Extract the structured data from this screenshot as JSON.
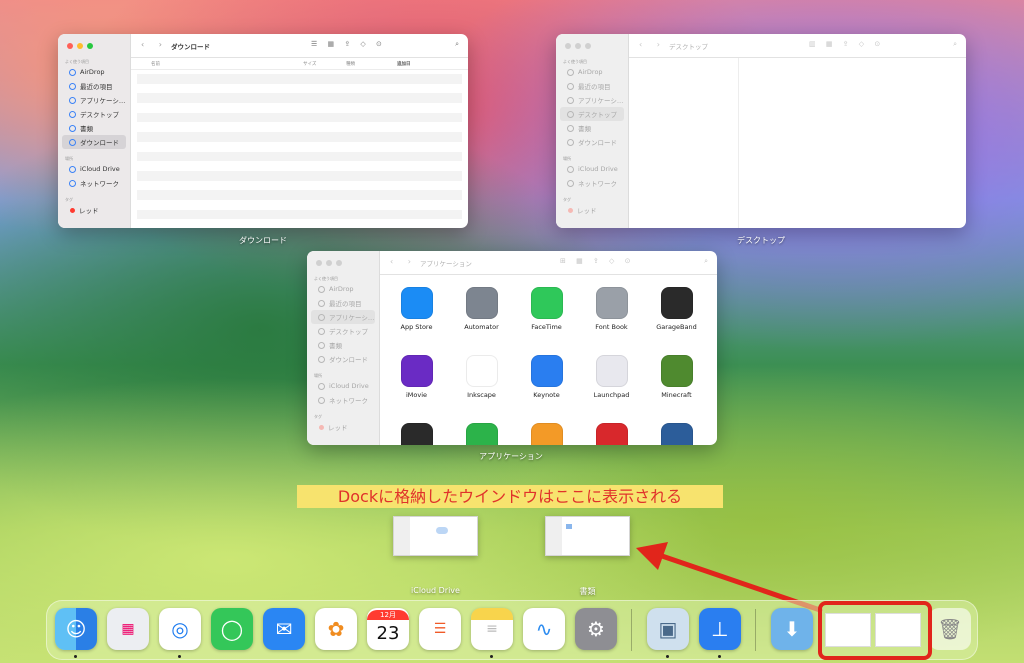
{
  "sidebar_labels": {
    "favorites": "よく使う項目",
    "locations": "場所",
    "tags": "タグ",
    "airdrop": "AirDrop",
    "recents": "最近の項目",
    "applications": "アプリケーシ…",
    "desktop": "デスクトップ",
    "documents": "書類",
    "downloads": "ダウンロード",
    "icloud": "iCloud Drive",
    "network": "ネットワーク",
    "red": "レッド"
  },
  "windows": {
    "downloads": {
      "title": "ダウンロード",
      "caption": "ダウンロード",
      "columns": [
        "名前",
        "サイズ",
        "種類",
        "追加日"
      ]
    },
    "desktop": {
      "title": "デスクトップ",
      "caption": "デスクトップ"
    },
    "applications": {
      "title": "アプリケーション",
      "caption": "アプリケーション",
      "apps": [
        {
          "name": "App Store",
          "icon": "app-store-icon",
          "color": "#1b8cf5"
        },
        {
          "name": "Automator",
          "icon": "automator-icon",
          "color": "#7d8590"
        },
        {
          "name": "FaceTime",
          "icon": "facetime-icon",
          "color": "#2fc85a"
        },
        {
          "name": "Font Book",
          "icon": "font-book-icon",
          "color": "#9aa0a8"
        },
        {
          "name": "GarageBand",
          "icon": "garageband-icon",
          "color": "#2a2a2a"
        },
        {
          "name": "iMovie",
          "icon": "imovie-icon",
          "color": "#6a2bc4"
        },
        {
          "name": "Inkscape",
          "icon": "inkscape-icon",
          "color": "#ffffff"
        },
        {
          "name": "Keynote",
          "icon": "keynote-icon",
          "color": "#2a7ef0"
        },
        {
          "name": "Launchpad",
          "icon": "launchpad-icon",
          "color": "#e8e8ee"
        },
        {
          "name": "Minecraft",
          "icon": "minecraft-icon",
          "color": "#4f8a2f"
        },
        {
          "name": "",
          "icon": "app-icon",
          "color": "#2a2a2a"
        },
        {
          "name": "",
          "icon": "numbers-icon",
          "color": "#2cb34a"
        },
        {
          "name": "",
          "icon": "pages-icon",
          "color": "#f39a27"
        },
        {
          "name": "",
          "icon": "photo-booth-icon",
          "color": "#d8282c"
        },
        {
          "name": "",
          "icon": "quicktime-icon",
          "color": "#2c5d9a"
        }
      ]
    }
  },
  "annotation": "Dockに格納したウインドウはここに表示される",
  "minimized": [
    {
      "label": "iCloud Drive"
    },
    {
      "label": "書類"
    }
  ],
  "dock": {
    "calendar_month": "12月",
    "calendar_day": "23",
    "icons": [
      "finder-icon",
      "launchpad-icon",
      "safari-icon",
      "messages-icon",
      "mail-icon",
      "photos-icon",
      "calendar-icon",
      "reminders-icon",
      "notes-icon",
      "freeform-icon",
      "system-settings-icon",
      "preview-icon",
      "keynote-icon",
      "downloads-folder-icon",
      "minimized-window-icon",
      "minimized-window-icon",
      "trash-icon"
    ]
  },
  "colors": {
    "annotation_bg": "#f7e36e",
    "annotation_text": "#e0322b",
    "highlight": "#e1251b"
  }
}
